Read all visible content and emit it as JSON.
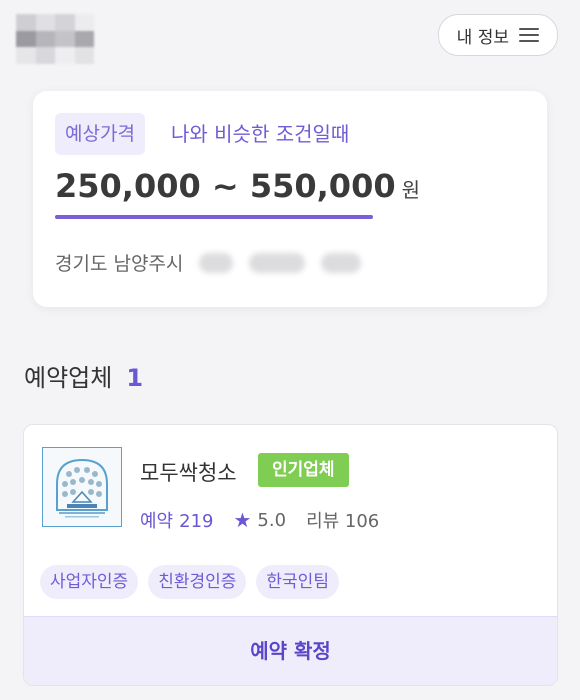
{
  "header": {
    "my_info_label": "내 정보"
  },
  "estimate": {
    "badge": "예상가격",
    "description": "나와 비슷한 조건일때",
    "price": "250,000 ~ 550,000",
    "unit": "원",
    "address": "경기도 남양주시"
  },
  "section": {
    "title": "예약업체",
    "count": "1"
  },
  "company": {
    "name": "모두싹청소",
    "badge": "인기업체",
    "reservations_label": "예약",
    "reservations": "219",
    "rating": "5.0",
    "reviews": "리뷰 106",
    "tags": [
      "사업자인증",
      "친환경인증",
      "한국인팀"
    ],
    "confirm_label": "예약 확정"
  },
  "colors": {
    "accent": "#6b56d4",
    "badge_bg": "#efecfb",
    "popular_green": "#7fcd52"
  },
  "icons": {
    "menu": "menu-icon",
    "star": "star-icon"
  }
}
